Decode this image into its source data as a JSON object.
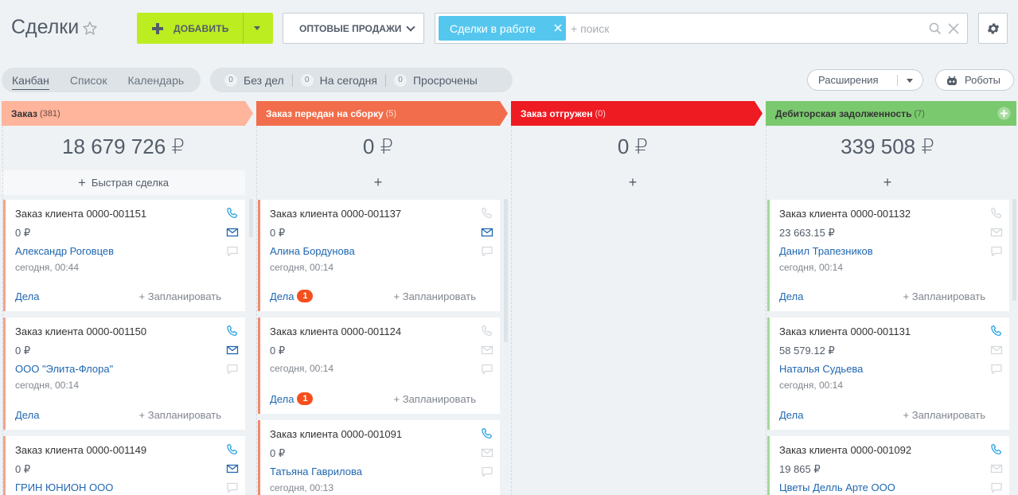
{
  "header": {
    "title": "Сделки",
    "add_label": "ДОБАВИТЬ",
    "category_label": "ОПТОВЫЕ ПРОДАЖИ",
    "filter_tag": "Сделки в работе",
    "search_placeholder": "+ поиск"
  },
  "toolbar": {
    "views": [
      "Канбан",
      "Список",
      "Календарь"
    ],
    "counters": [
      {
        "count": "0",
        "label": "Без дел"
      },
      {
        "count": "0",
        "label": "На сегодня"
      },
      {
        "count": "0",
        "label": "Просрочены"
      }
    ],
    "extensions_label": "Расширения",
    "robots_label": "Роботы"
  },
  "colors": {
    "accent_green": "#bbed21",
    "filter_blue": "#55c7ef",
    "stage1": "#ffb49c",
    "stage2": "#f26d4b",
    "stage3": "#ee1b22",
    "stage4": "#7bc96f",
    "link": "#2067b0"
  },
  "columns": [
    {
      "title": "Заказ",
      "count": "(381)",
      "sum": "18 679 726 ₽",
      "quick": "Быстрая сделка",
      "cards": [
        {
          "title": "Заказ клиента 0000-001151",
          "sum": "0 ₽",
          "contact": "Александр Роговцев",
          "date": "сегодня, 00:44",
          "acts": "Дела",
          "badge": "",
          "plan": "+ Запланировать"
        },
        {
          "title": "Заказ клиента 0000-001150",
          "sum": "0 ₽",
          "contact": "ООО \"Элита-Флора\"",
          "date": "сегодня, 00:14",
          "acts": "Дела",
          "badge": "",
          "plan": "+ Запланировать"
        },
        {
          "title": "Заказ клиента 0000-001149",
          "sum": "0 ₽",
          "contact": "ГРИН ЮНИОН ООО",
          "date": "",
          "acts": "",
          "badge": "",
          "plan": ""
        }
      ]
    },
    {
      "title": "Заказ передан на сборку",
      "count": "(5)",
      "sum": "0 ₽",
      "quick": "+",
      "cards": [
        {
          "title": "Заказ клиента 0000-001137",
          "sum": "0 ₽",
          "contact": "Алина Бордунова",
          "date": "сегодня, 00:14",
          "acts": "Дела",
          "badge": "1",
          "plan": "+ Запланировать"
        },
        {
          "title": "Заказ клиента 0000-001124",
          "sum": "0 ₽",
          "contact": "",
          "date": "сегодня, 00:14",
          "acts": "Дела",
          "badge": "1",
          "plan": "+ Запланировать"
        },
        {
          "title": "Заказ клиента 0000-001091",
          "sum": "0 ₽",
          "contact": "Татьяна Гаврилова",
          "date": "сегодня, 00:13",
          "acts": "",
          "badge": "",
          "plan": ""
        }
      ]
    },
    {
      "title": "Заказ отгружен",
      "count": "(0)",
      "sum": "0 ₽",
      "quick": "+",
      "cards": []
    },
    {
      "title": "Дебиторская задолженность",
      "count": "(7)",
      "sum": "339 508 ₽",
      "quick": "+",
      "cards": [
        {
          "title": "Заказ клиента 0000-001132",
          "sum": "23 663.15 ₽",
          "contact": "Данил Трапезников",
          "date": "сегодня, 00:14",
          "acts": "Дела",
          "badge": "",
          "plan": "+ Запланировать"
        },
        {
          "title": "Заказ клиента 0000-001131",
          "sum": "58 579.12 ₽",
          "contact": "Наталья Судьева",
          "date": "сегодня, 00:14",
          "acts": "Дела",
          "badge": "",
          "plan": "+ Запланировать"
        },
        {
          "title": "Заказ клиента 0000-001092",
          "sum": "19 865 ₽",
          "contact": "Цветы Делль Арте ООО",
          "date": "",
          "acts": "",
          "badge": "",
          "plan": ""
        }
      ]
    }
  ]
}
